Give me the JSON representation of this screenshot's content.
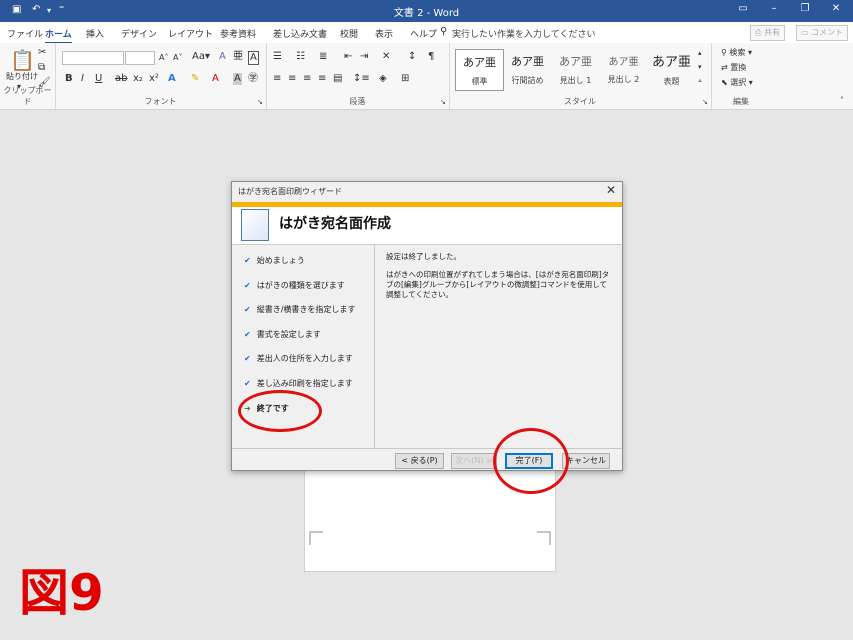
{
  "window": {
    "title": "文書 2 - Word"
  },
  "ribbon_tabs": [
    "ファイル",
    "ホーム",
    "挿入",
    "デザイン",
    "レイアウト",
    "参考資料",
    "差し込み文書",
    "校閲",
    "表示",
    "ヘルプ"
  ],
  "tell_me": "実行したい作業を入力してください",
  "share_label": "共有",
  "comment_label": "コメント",
  "clipboard": {
    "paste_label": "貼り付け",
    "group_label": "クリップボード"
  },
  "font": {
    "group_label": "フォント",
    "aa_label": "Aa"
  },
  "paragraph": {
    "group_label": "段落"
  },
  "styles": {
    "group_label": "スタイル",
    "items": [
      {
        "sample": "あア亜",
        "name": "標準"
      },
      {
        "sample": "あア亜",
        "name": "行間詰め"
      },
      {
        "sample": "あア亜",
        "name": "見出し 1"
      },
      {
        "sample": "あア亜",
        "name": "見出し 2"
      },
      {
        "sample": "あア亜",
        "name": "表題"
      }
    ]
  },
  "editing": {
    "group_label": "編集",
    "find": "検索",
    "replace": "置換",
    "select": "選択"
  },
  "dialog": {
    "title": "はがき宛名面印刷ウィザード",
    "heading": "はがき宛名面作成",
    "steps": [
      {
        "label": "始めましょう"
      },
      {
        "label": "はがきの種類を選びます"
      },
      {
        "label": "縦書き/横書きを指定します"
      },
      {
        "label": "書式を設定します"
      },
      {
        "label": "差出人の住所を入力します"
      },
      {
        "label": "差し込み印刷を指定します"
      },
      {
        "label": "終了です"
      }
    ],
    "message1": "設定は終了しました。",
    "message2": "はがきへの印刷位置がずれてしまう場合は、[はがき宛名面印刷]タブの[編集]グループから[レイアウトの微調整]コマンドを使用して調整してください。",
    "back_button": "< 戻る(P)",
    "next_button": "次へ(N) >",
    "finish_button": "完了(F)",
    "cancel_button": "キャンセル"
  },
  "figure_label": "図9",
  "colors": {
    "title_bar": "#2b579a",
    "banner": "#f6b100",
    "annotation": "#e01010"
  }
}
